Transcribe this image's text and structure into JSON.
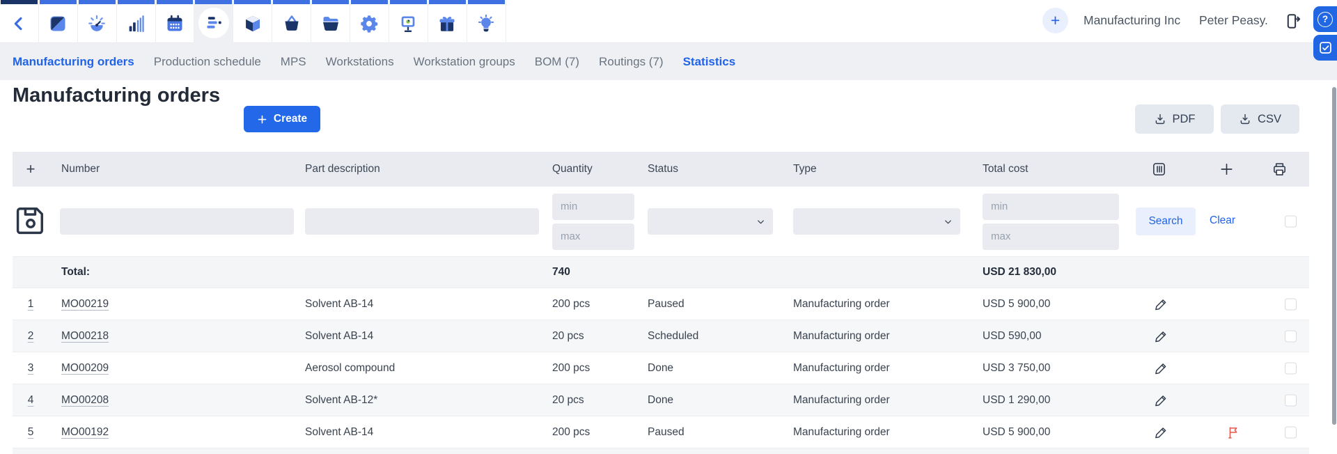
{
  "colors": {
    "accent": "#2268e8",
    "icon_navy": "#1c3569",
    "icon_blue": "#5b87ea",
    "flag_red": "#e4564a"
  },
  "topbar": {
    "icons": [
      {
        "name": "back"
      },
      {
        "name": "app-logo"
      },
      {
        "name": "dashboard"
      },
      {
        "name": "statistics"
      },
      {
        "name": "calendar"
      },
      {
        "name": "production-planning",
        "active": true
      },
      {
        "name": "stock"
      },
      {
        "name": "procurement"
      },
      {
        "name": "documents"
      },
      {
        "name": "settings"
      },
      {
        "name": "marketing"
      },
      {
        "name": "rewards"
      },
      {
        "name": "ideas"
      }
    ],
    "add_label": "+",
    "company": "Manufacturing Inc",
    "user": "Peter Peasy.",
    "help_label": "?"
  },
  "nav": {
    "items": [
      {
        "label": "Manufacturing orders",
        "active": true
      },
      {
        "label": "Production schedule"
      },
      {
        "label": "MPS"
      },
      {
        "label": "Workstations"
      },
      {
        "label": "Workstation groups"
      },
      {
        "label": "BOM (7)"
      },
      {
        "label": "Routings (7)"
      },
      {
        "label": "Statistics",
        "accent": true
      }
    ]
  },
  "page": {
    "title": "Manufacturing orders",
    "create_label": "Create",
    "pdf_label": "PDF",
    "csv_label": "CSV"
  },
  "table": {
    "headers": {
      "add": "+",
      "number": "Number",
      "part": "Part description",
      "quantity": "Quantity",
      "status": "Status",
      "type": "Type",
      "total_cost": "Total cost"
    },
    "header_icons": [
      {
        "name": "columns-settings"
      },
      {
        "name": "add-column"
      },
      {
        "name": "print"
      }
    ],
    "filters": {
      "min_placeholder": "min",
      "max_placeholder": "max",
      "search_label": "Search",
      "clear_label": "Clear"
    },
    "total": {
      "label": "Total:",
      "quantity": "740",
      "cost": "USD 21 830,00"
    },
    "rows": [
      {
        "index": "1",
        "number": "MO00219",
        "part": "Solvent AB-14",
        "quantity": "200 pcs",
        "status": "Paused",
        "type": "Manufacturing order",
        "cost": "USD 5 900,00",
        "flagged": false
      },
      {
        "index": "2",
        "number": "MO00218",
        "part": "Solvent AB-14",
        "quantity": "20 pcs",
        "status": "Scheduled",
        "type": "Manufacturing order",
        "cost": "USD 590,00",
        "flagged": false
      },
      {
        "index": "3",
        "number": "MO00209",
        "part": "Aerosol compound",
        "quantity": "200 pcs",
        "status": "Done",
        "type": "Manufacturing order",
        "cost": "USD 3 750,00",
        "flagged": false
      },
      {
        "index": "4",
        "number": "MO00208",
        "part": "Solvent AB-12*",
        "quantity": "20 pcs",
        "status": "Done",
        "type": "Manufacturing order",
        "cost": "USD 1 290,00",
        "flagged": false
      },
      {
        "index": "5",
        "number": "MO00192",
        "part": "Solvent AB-14",
        "quantity": "200 pcs",
        "status": "Paused",
        "type": "Manufacturing order",
        "cost": "USD 5 900,00",
        "flagged": true
      }
    ]
  }
}
